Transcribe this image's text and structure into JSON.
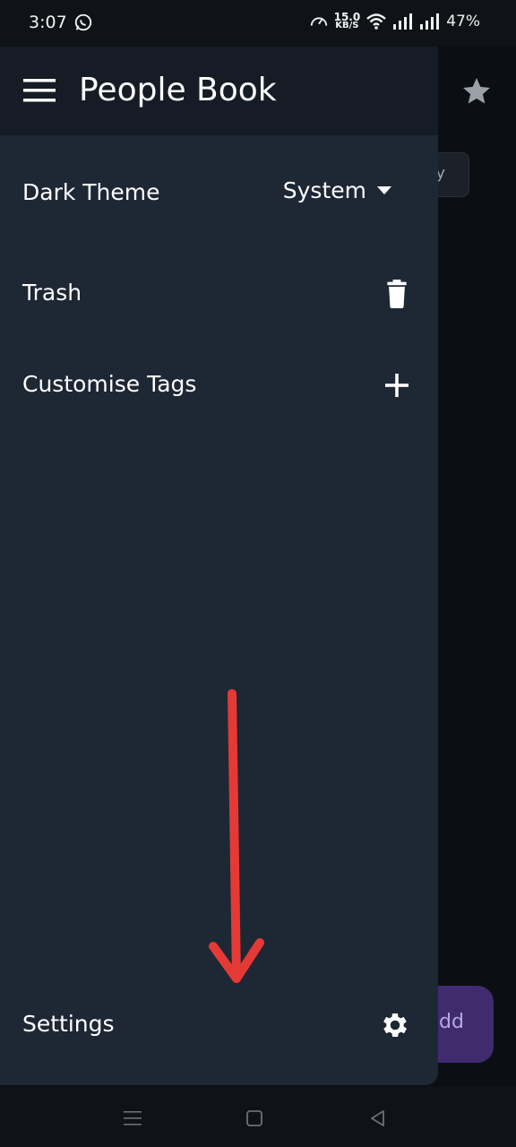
{
  "status_bar": {
    "time": "3:07",
    "net_speed_value": "15.0",
    "net_speed_unit": "KB/S",
    "battery": "47%"
  },
  "drawer": {
    "title": "People Book",
    "items": [
      {
        "label": "Dark Theme",
        "value": "System",
        "icon": "caret-down-icon"
      },
      {
        "label": "Trash",
        "icon": "trash-icon"
      },
      {
        "label": "Customise Tags",
        "icon": "plus-icon"
      }
    ],
    "footer": {
      "label": "Settings",
      "icon": "gear-icon"
    }
  },
  "background": {
    "chip_text": "y",
    "fab_label_partial": "dd"
  },
  "colors": {
    "drawer_bg": "#1e2734",
    "header_bg": "#151c25",
    "annotation_arrow": "#e53935",
    "fab": "#3f2b6e"
  }
}
